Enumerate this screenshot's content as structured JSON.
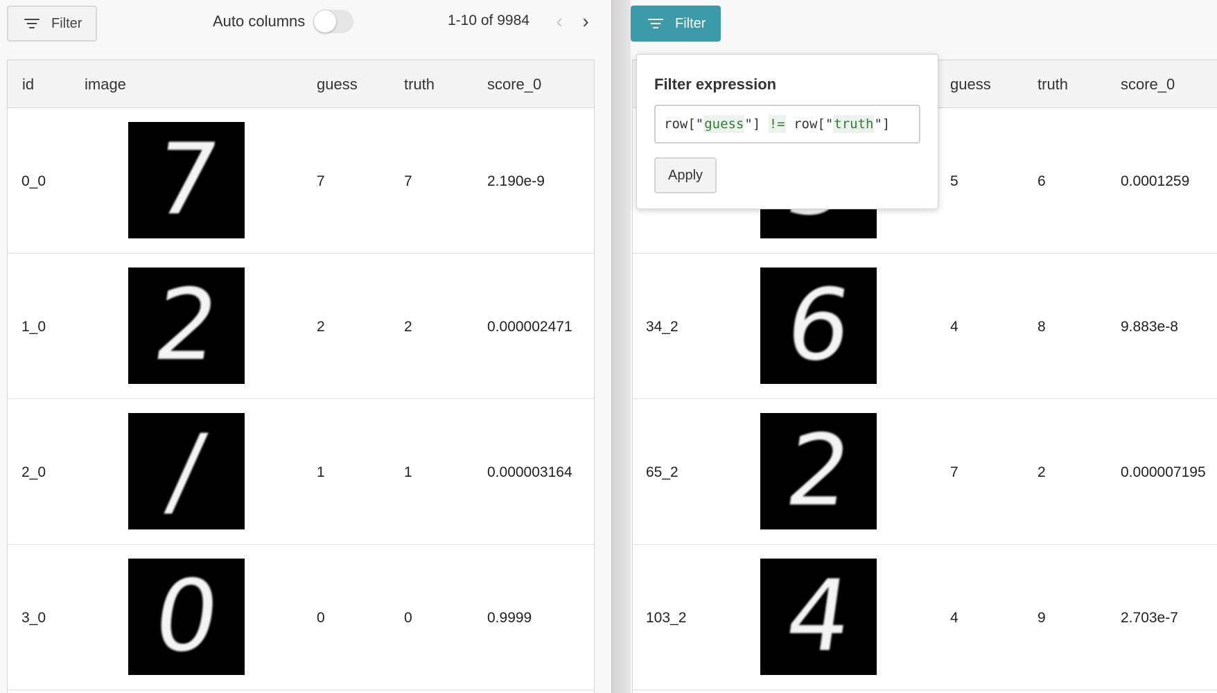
{
  "left": {
    "filter_label": "Filter",
    "auto_columns_label": "Auto columns",
    "auto_columns_on": false,
    "pager_text": "1-10 of 9984",
    "prev_icon": "chevron-left-icon",
    "next_icon": "chevron-right-icon",
    "headers": [
      "id",
      "image",
      "guess",
      "truth",
      "score_0"
    ],
    "rows": [
      {
        "id": "0_0",
        "digit": "7",
        "guess": "7",
        "truth": "7",
        "score": "2.190e-9"
      },
      {
        "id": "1_0",
        "digit": "2",
        "guess": "2",
        "truth": "2",
        "score": "0.000002471"
      },
      {
        "id": "2_0",
        "digit": "/",
        "guess": "1",
        "truth": "1",
        "score": "0.000003164"
      },
      {
        "id": "3_0",
        "digit": "0",
        "guess": "0",
        "truth": "0",
        "score": "0.9999"
      }
    ]
  },
  "right": {
    "filter_label": "Filter",
    "headers": [
      "guess",
      "truth",
      "score_0"
    ],
    "rows": [
      {
        "id": "",
        "digit": "5",
        "guess": "5",
        "truth": "6",
        "score": "0.0001259"
      },
      {
        "id": "34_2",
        "digit": "6",
        "guess": "4",
        "truth": "8",
        "score": "9.883e-8"
      },
      {
        "id": "65_2",
        "digit": "2",
        "guess": "7",
        "truth": "2",
        "score": "0.000007195"
      },
      {
        "id": "103_2",
        "digit": "4",
        "guess": "4",
        "truth": "9",
        "score": "2.703e-7"
      }
    ]
  },
  "popover": {
    "title": "Filter expression",
    "expr": {
      "p1": "row[\"",
      "s1": "guess",
      "p2": "\"] ",
      "op": "!=",
      "p3": " row[\"",
      "s2": "truth",
      "p4": "\"]"
    },
    "apply_label": "Apply"
  },
  "colors": {
    "accent": "#3d9aa8",
    "code_green": "#2f7d32"
  }
}
